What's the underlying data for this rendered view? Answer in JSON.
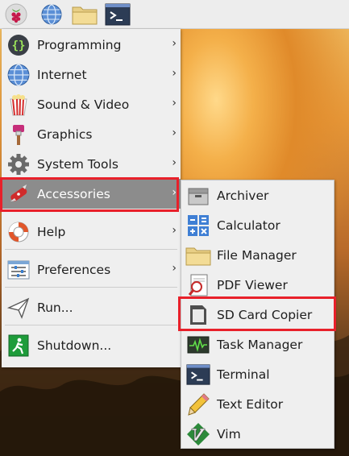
{
  "taskbar": {
    "buttons": [
      {
        "name": "raspberry-menu-button",
        "icon": "raspberry-icon"
      },
      {
        "name": "web-browser-button",
        "icon": "globe-icon"
      },
      {
        "name": "file-manager-button",
        "icon": "folder-icon"
      },
      {
        "name": "terminal-button",
        "icon": "terminal-icon"
      }
    ]
  },
  "main_menu": {
    "items": [
      {
        "label": "Programming",
        "icon": "programming-icon",
        "submenu": true
      },
      {
        "label": "Internet",
        "icon": "globe-icon",
        "submenu": true
      },
      {
        "label": "Sound & Video",
        "icon": "sound-video-icon",
        "submenu": true
      },
      {
        "label": "Graphics",
        "icon": "graphics-icon",
        "submenu": true
      },
      {
        "label": "System Tools",
        "icon": "gear-icon",
        "submenu": true
      },
      {
        "label": "Accessories",
        "icon": "swiss-knife-icon",
        "submenu": true,
        "selected": true
      },
      {
        "label": "Help",
        "icon": "lifebuoy-icon",
        "submenu": true
      },
      {
        "label": "Preferences",
        "icon": "preferences-icon",
        "submenu": true
      },
      {
        "label": "Run...",
        "icon": "paper-plane-icon",
        "submenu": false
      },
      {
        "label": "Shutdown...",
        "icon": "exit-icon",
        "submenu": false
      }
    ],
    "arrow_glyph": "›"
  },
  "accessories_menu": {
    "items": [
      {
        "label": "Archiver",
        "icon": "archiver-icon"
      },
      {
        "label": "Calculator",
        "icon": "calculator-icon"
      },
      {
        "label": "File Manager",
        "icon": "folder-icon"
      },
      {
        "label": "PDF Viewer",
        "icon": "pdf-viewer-icon"
      },
      {
        "label": "SD Card Copier",
        "icon": "sd-card-icon",
        "highlighted": true
      },
      {
        "label": "Task Manager",
        "icon": "task-manager-icon"
      },
      {
        "label": "Terminal",
        "icon": "terminal-icon"
      },
      {
        "label": "Text Editor",
        "icon": "text-editor-icon"
      },
      {
        "label": "Vim",
        "icon": "vim-icon"
      }
    ]
  },
  "colors": {
    "highlight_border": "#e8202a",
    "selected_row": "#8c8c8c",
    "menu_bg": "#efefef"
  }
}
